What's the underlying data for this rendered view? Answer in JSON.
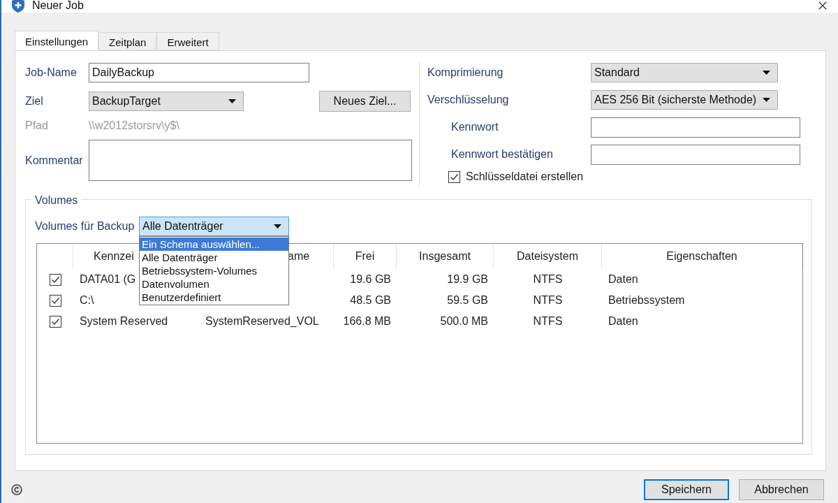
{
  "window": {
    "title": "Neuer Job"
  },
  "tabs": [
    {
      "label": "Einstellungen",
      "selected": true
    },
    {
      "label": "Zeitplan",
      "selected": false
    },
    {
      "label": "Erweitert",
      "selected": false
    }
  ],
  "general": {
    "job_name": {
      "label": "Job-Name",
      "value": "DailyBackup"
    },
    "target": {
      "label": "Ziel",
      "value": "BackupTarget"
    },
    "new_target_button": "Neues Ziel...",
    "path": {
      "label": "Pfad",
      "value": "\\\\w2012storsrv\\y$\\"
    },
    "comment": {
      "label": "Kommentar"
    }
  },
  "security": {
    "compression": {
      "label": "Komprimierung",
      "value": "Standard"
    },
    "encryption": {
      "label": "Verschlüsselung",
      "value": "AES 256 Bit (sicherste Methode)"
    },
    "password": {
      "label": "Kennwort"
    },
    "password_confirm": {
      "label": "Kennwort bestätigen"
    },
    "key_file": {
      "label": "Schlüsseldatei erstellen",
      "checked": true
    }
  },
  "volumes": {
    "title": "Volumes",
    "select_label": "Volumes für Backup",
    "select_value": "Alle Datenträger",
    "options": [
      {
        "label": "Ein Schema auswählen...",
        "selected": true
      },
      {
        "label": "Alle Datenträger",
        "selected": false
      },
      {
        "label": "Betriebssystem-Volumes",
        "selected": false
      },
      {
        "label": "Datenvolumen",
        "selected": false
      },
      {
        "label": "Benutzerdefiniert",
        "selected": false
      }
    ],
    "table": {
      "columns": [
        "Kennzei",
        "ame",
        "Frei",
        "Insgesamt",
        "Dateisystem",
        "Eigenschaften"
      ],
      "rows": [
        {
          "checked": true,
          "label": "DATA01 (G",
          "free": "19.6 GB",
          "total": "19.9 GB",
          "fs": "NTFS",
          "props": "Daten"
        },
        {
          "checked": true,
          "label": "C:\\",
          "free": "48.5 GB",
          "total": "59.5 GB",
          "fs": "NTFS",
          "props": "Betriebssystem"
        },
        {
          "checked": true,
          "label": "System Reserved",
          "name": "SystemReserved_VOL",
          "free": "166.8 MB",
          "total": "500.0 MB",
          "fs": "NTFS",
          "props": "Daten"
        }
      ]
    }
  },
  "buttons": [
    {
      "label": "Speichern",
      "default": true
    },
    {
      "label": "Abbrechen",
      "default": false
    }
  ]
}
